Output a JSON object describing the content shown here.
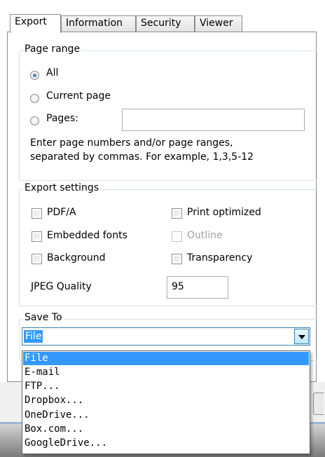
{
  "tabs": [
    "Export",
    "Information",
    "Security",
    "Viewer"
  ],
  "page_range": {
    "legend": "Page range",
    "options": [
      "All",
      "Current page",
      "Pages:"
    ],
    "selected": "All",
    "pages_value": "",
    "hint_line1": "Enter page numbers and/or page ranges,",
    "hint_line2": "separated by commas. For example, 1,3,5-12"
  },
  "export_settings": {
    "legend": "Export settings",
    "checkboxes": [
      {
        "label": "PDF/A",
        "checked": false,
        "enabled": true
      },
      {
        "label": "Print optimized",
        "checked": false,
        "enabled": true
      },
      {
        "label": "Embedded fonts",
        "checked": false,
        "enabled": true
      },
      {
        "label": "Outline",
        "checked": false,
        "enabled": false
      },
      {
        "label": "Background",
        "checked": false,
        "enabled": true
      },
      {
        "label": "Transparency",
        "checked": false,
        "enabled": true
      }
    ],
    "jpeg_quality_label": "JPEG Quality",
    "jpeg_quality_value": "95"
  },
  "save_to": {
    "legend": "Save To",
    "selected": "File",
    "options": [
      "File",
      "E-mail",
      "FTP...",
      "Dropbox...",
      "OneDrive...",
      "Box.com...",
      "GoogleDrive..."
    ]
  }
}
